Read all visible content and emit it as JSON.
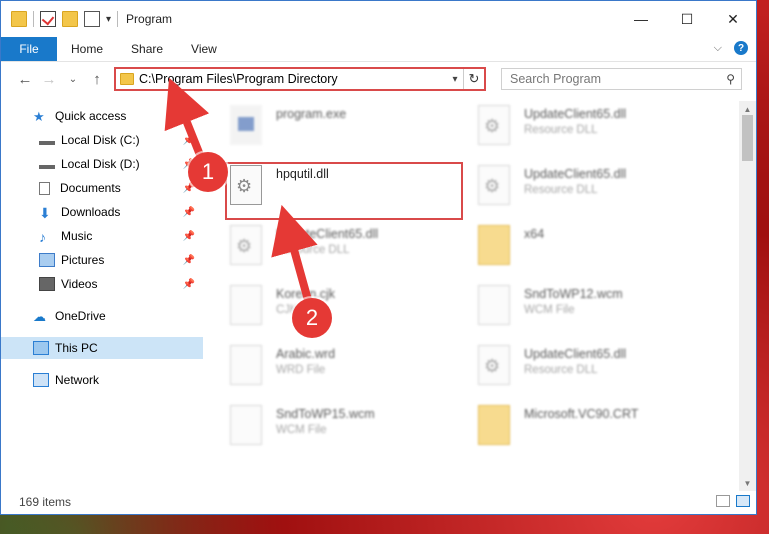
{
  "window": {
    "title": "Program",
    "controls": {
      "minimize": "—",
      "maximize": "☐",
      "close": "✕"
    }
  },
  "ribbon": {
    "tabs": [
      "File",
      "Home",
      "Share",
      "View"
    ],
    "help": "?"
  },
  "address": {
    "path": "C:\\Program Files\\Program Directory",
    "search_placeholder": "Search Program"
  },
  "nav": {
    "items": [
      {
        "label": "Quick access",
        "icon": "star-icon",
        "pinned": false
      },
      {
        "label": "Local Disk (C:)",
        "icon": "drive-icon",
        "pinned": true
      },
      {
        "label": "Local Disk (D:)",
        "icon": "drive-icon",
        "pinned": true
      },
      {
        "label": "Documents",
        "icon": "documents-icon",
        "pinned": true
      },
      {
        "label": "Downloads",
        "icon": "download-icon",
        "pinned": true
      },
      {
        "label": "Music",
        "icon": "music-icon",
        "pinned": true
      },
      {
        "label": "Pictures",
        "icon": "pictures-icon",
        "pinned": true
      },
      {
        "label": "Videos",
        "icon": "videos-icon",
        "pinned": true
      },
      {
        "label": "OneDrive",
        "icon": "cloud-icon",
        "pinned": false
      },
      {
        "label": "This PC",
        "icon": "computer-icon",
        "pinned": false
      },
      {
        "label": "Network",
        "icon": "network-icon",
        "pinned": false
      }
    ]
  },
  "files": [
    {
      "name": "program.exe",
      "type": "",
      "icon": "exe"
    },
    {
      "name": "UpdateClient65.dll",
      "type": "Resource DLL",
      "icon": "gear"
    },
    {
      "name": "hpqutil.dll",
      "type": "",
      "icon": "gear"
    },
    {
      "name": "UpdateClient65.dll",
      "type": "Resource DLL",
      "icon": "gear"
    },
    {
      "name": "UpdateClient65.dll",
      "type": "Resource DLL",
      "icon": "gear"
    },
    {
      "name": "x64",
      "type": "",
      "icon": "folder"
    },
    {
      "name": "Korean.cjk",
      "type": "CJK File",
      "icon": "doc"
    },
    {
      "name": "SndToWP12.wcm",
      "type": "WCM File",
      "icon": "doc"
    },
    {
      "name": "Arabic.wrd",
      "type": "WRD File",
      "icon": "doc"
    },
    {
      "name": "UpdateClient65.dll",
      "type": "Resource DLL",
      "icon": "gear"
    },
    {
      "name": "SndToWP15.wcm",
      "type": "WCM File",
      "icon": "doc"
    },
    {
      "name": "Microsoft.VC90.CRT",
      "type": "",
      "icon": "folder"
    }
  ],
  "status": {
    "items_count": "169 items"
  },
  "annotations": {
    "step1": "1",
    "step2": "2"
  },
  "colors": {
    "accent": "#1979ca",
    "highlight": "#d94a4a",
    "selection": "#cce4f7"
  }
}
